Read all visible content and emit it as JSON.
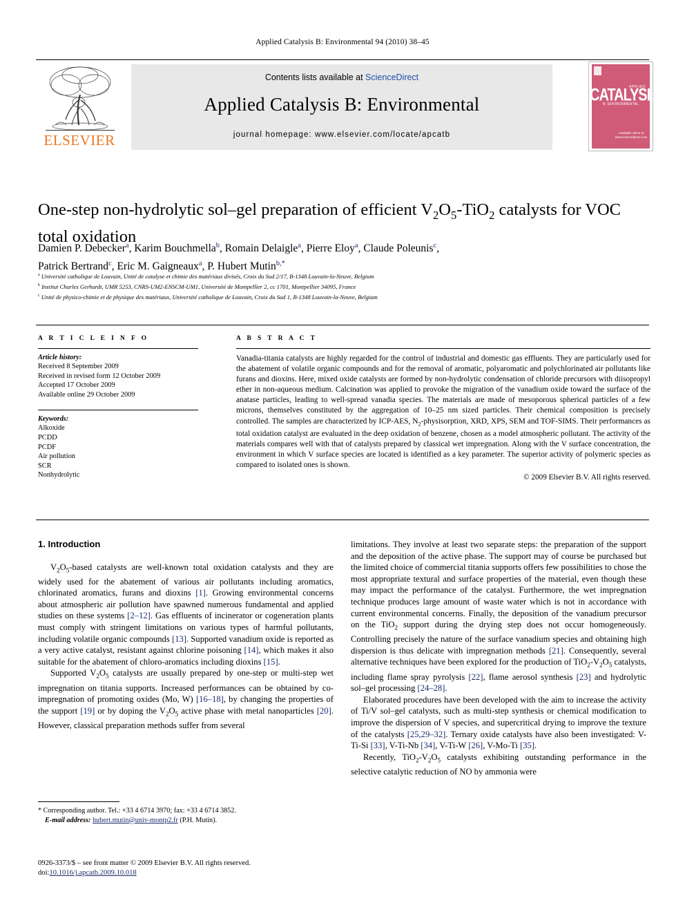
{
  "running_head": "Applied Catalysis B: Environmental 94 (2010) 38–45",
  "masthead": {
    "contents_prefix": "Contents lists available at ",
    "sciencedirect": "ScienceDirect",
    "journal_title": "Applied Catalysis B: Environmental",
    "homepage": "journal homepage: www.elsevier.com/locate/apcatb",
    "publisher_name": "ELSEVIER",
    "cover": {
      "applied": "APPLIED",
      "title": "CATALYSIS",
      "subtitle": "B: ENVIRONMENTAL",
      "sciencedirect": "ScienceDirect",
      "foot": "Available online at www.sciencedirect.com",
      "color": "#cf5b77"
    }
  },
  "article": {
    "title_part1": "One-step non-hydrolytic sol–gel preparation of efficient V",
    "title_sub1": "2",
    "title_part2": "O",
    "title_sub2": "5",
    "title_part3": "-TiO",
    "title_sub3": "2",
    "title_part4": " catalysts for VOC total oxidation",
    "authors_line1": "Damien P. Debecker a, Karim Bouchmella b, Romain Delaigle a, Pierre Eloy a, Claude Poleunis c,",
    "authors_line2": "Patrick Bertrand c, Eric M. Gaigneaux a, P. Hubert Mutin b*",
    "affiliations": [
      "a Université catholique de Louvain, Unité de catalyse et chimie des matériaux divisés, Croix du Sud 2/17, B-1348 Louvain-la-Neuve, Belgium",
      "b Institut Charles Gerhardt, UMR 5253, CNRS-UM2-ENSCM-UM1, Université de Montpellier 2, cc 1701, Montpellier 34095, France",
      "c Unité de physico-chimie et de physique des matériaux, Université catholique de Louvain, Croix du Sud 1, B-1348 Louvain-la-Neuve, Belgium"
    ]
  },
  "article_info": {
    "heading": "A R T I C L E   I N F O",
    "history_label": "Article history:",
    "history": [
      "Received 8 September 2009",
      "Received in revised form 12 October 2009",
      "Accepted 17 October 2009",
      "Available online 29 October 2009"
    ],
    "keywords_label": "Keywords:",
    "keywords": [
      "Alkoxide",
      "PCDD",
      "PCDF",
      "Air pollution",
      "SCR",
      "Nonhydrolytic"
    ]
  },
  "abstract": {
    "heading": "A B S T R A C T",
    "text": "Vanadia-titania catalysts are highly regarded for the control of industrial and domestic gas effluents. They are particularly used for the abatement of volatile organic compounds and for the removal of aromatic, polyaromatic and polychlorinated air pollutants like furans and dioxins. Here, mixed oxide catalysts are formed by non-hydrolytic condensation of chloride precursors with diisopropyl ether in non-aqueous medium. Calcination was applied to provoke the migration of the vanadium oxide toward the surface of the anatase particles, leading to well-spread vanadia species. The materials are made of mesoporous spherical particles of a few microns, themselves constituted by the aggregation of 10–25 nm sized particles. Their chemical composition is precisely controlled. The samples are characterized by ICP-AES, N2-physisorption, XRD, XPS, SEM and TOF-SIMS. Their performances as total oxidation catalyst are evaluated in the deep oxidation of benzene, chosen as a model atmospheric pollutant. The activity of the materials compares well with that of catalysts prepared by classical wet impregnation. Along with the V surface concentration, the environment in which V surface species are located is identified as a key parameter. The superior activity of polymeric species as compared to isolated ones is shown.",
    "copyright": "© 2009 Elsevier B.V. All rights reserved."
  },
  "body": {
    "section_heading": "1. Introduction",
    "left_p1": "V2O5-based catalysts are well-known total oxidation catalysts and they are widely used for the abatement of various air pollutants including aromatics, chlorinated aromatics, furans and dioxins [1]. Growing environmental concerns about atmospheric air pollution have spawned numerous fundamental and applied studies on these systems [2–12]. Gas effluents of incinerator or cogeneration plants must comply with stringent limitations on various types of harmful pollutants, including volatile organic compounds [13]. Supported vanadium oxide is reported as a very active catalyst, resistant against chlorine poisoning [14], which makes it also suitable for the abatement of chloro-aromatics including dioxins [15].",
    "left_p2": "Supported V2O5 catalysts are usually prepared by one-step or multi-step wet impregnation on titania supports. Increased performances can be obtained by co-impregnation of promoting oxides (Mo, W) [16–18], by changing the properties of the support [19] or by doping the V2O5 active phase with metal nanoparticles [20]. However, classical preparation methods suffer from several",
    "right_p1": "limitations. They involve at least two separate steps: the preparation of the support and the deposition of the active phase. The support may of course be purchased but the limited choice of commercial titania supports offers few possibilities to chose the most appropriate textural and surface properties of the material, even though these may impact the performance of the catalyst. Furthermore, the wet impregnation technique produces large amount of waste water which is not in accordance with current environmental concerns. Finally, the deposition of the vanadium precursor on the TiO2 support during the drying step does not occur homogeneously. Controlling precisely the nature of the surface vanadium species and obtaining high dispersion is thus delicate with impregnation methods [21]. Consequently, several alternative techniques have been explored for the production of TiO2-V2O5 catalysts, including flame spray pyrolysis [22], flame aerosol synthesis [23] and hydrolytic sol–gel processing [24–28].",
    "right_p2": "Elaborated procedures have been developed with the aim to increase the activity of Ti/V sol–gel catalysts, such as multi-step synthesis or chemical modification to improve the dispersion of V species, and supercritical drying to improve the texture of the catalysts [25,29–32]. Ternary oxide catalysts have also been investigated: V-Ti-Si [33], V-Ti-Nb [34], V-Ti-W [26], V-Mo-Ti [35].",
    "right_p3": "Recently, TiO2-V2O5 catalysts exhibiting outstanding performance in the selective catalytic reduction of NO by ammonia were"
  },
  "footnote": {
    "marker": "*",
    "corresponding": "Corresponding author. Tel.: +33 4 6714 3970; fax: +33 4 6714 3852.",
    "email_label": "E-mail address:",
    "email": "hubert.mutin@univ-montp2.fr",
    "email_suffix": "(P.H. Mutin)."
  },
  "footer": {
    "issn_line": "0926-3373/$ – see front matter © 2009 Elsevier B.V. All rights reserved.",
    "doi_label": "doi:",
    "doi_value": "10.1016/j.apcatb.2009.10.018"
  }
}
